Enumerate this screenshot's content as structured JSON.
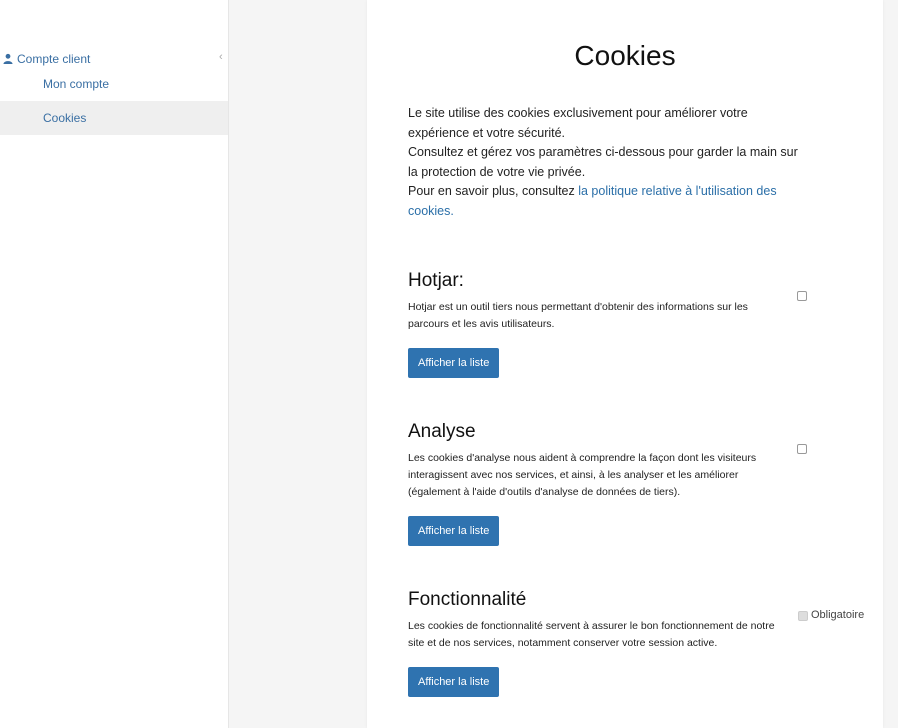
{
  "sidebar": {
    "header_label": "Compte client",
    "items": [
      {
        "label": "Mon compte",
        "active": false
      },
      {
        "label": "Cookies",
        "active": true
      }
    ]
  },
  "main": {
    "title": "Cookies",
    "intro": {
      "line1": "Le site utilise des cookies exclusivement pour améliorer votre expérience et votre sécurité.",
      "line2": "Consultez et gérez vos paramètres ci-dessous pour garder la main sur la protection de votre vie privée.",
      "line3_prefix": "Pour en savoir plus, consultez ",
      "line3_link": "la politique relative à l'utilisation des cookies."
    },
    "sections": [
      {
        "title": "Hotjar:",
        "description": "Hotjar est un outil tiers nous permettant d'obtenir des informations sur les parcours et les avis utilisateurs.",
        "button_label": "Afficher la liste",
        "checked": false
      },
      {
        "title": "Analyse",
        "description": "Les cookies d'analyse nous aident à comprendre la façon dont les visiteurs interagissent avec nos services, et ainsi, à les analyser et les améliorer (également à l'aide d'outils d'analyse de données de tiers).",
        "button_label": "Afficher la liste",
        "checked": false
      },
      {
        "title": "Fonctionnalité",
        "description": "Les cookies de fonctionnalité servent à assurer le bon fonctionnement de notre site et de nos services, notamment conserver votre session active.",
        "button_label": "Afficher la liste",
        "checked": true,
        "mandatory_label": "Obligatoire"
      }
    ]
  },
  "colors": {
    "accent": "#2f73b0",
    "link": "#3a6fa3"
  },
  "icons": {
    "sidebar_header": "user-icon",
    "collapse": "chevron-left-icon"
  }
}
